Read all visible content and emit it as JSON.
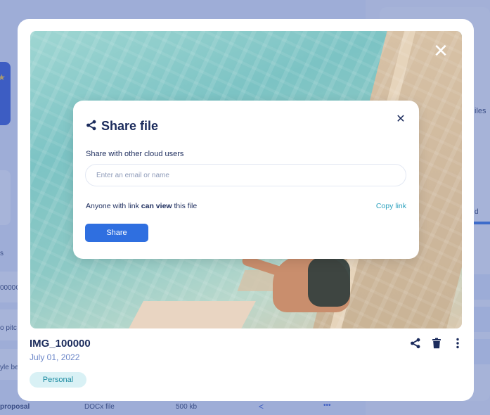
{
  "background": {
    "right_label": "iles",
    "right_label_2": "d",
    "left_rows": [
      "s",
      "0000C",
      "o pitc",
      "yle be"
    ],
    "bottom_row": {
      "name": "proposal",
      "type": "DOCx file",
      "size": "500 kb"
    }
  },
  "preview": {
    "file_name": "IMG_100000",
    "date": "July 01, 2022",
    "tag": "Personal"
  },
  "share": {
    "title": "Share file",
    "subtitle": "Share with other cloud users",
    "input_placeholder": "Enter an email or name",
    "input_value": "",
    "perm_prefix": "Anyone with link ",
    "perm_bold": "can view",
    "perm_suffix": " this file",
    "copy_link": "Copy link",
    "share_button": "Share"
  },
  "colors": {
    "primary": "#2f6fe0",
    "navy": "#1b2b5c",
    "accent_teal": "#2aa0bd",
    "tag_bg": "#d9f1f5"
  },
  "icons": [
    "close-icon",
    "share-icon",
    "trash-icon",
    "more-vertical-icon"
  ]
}
